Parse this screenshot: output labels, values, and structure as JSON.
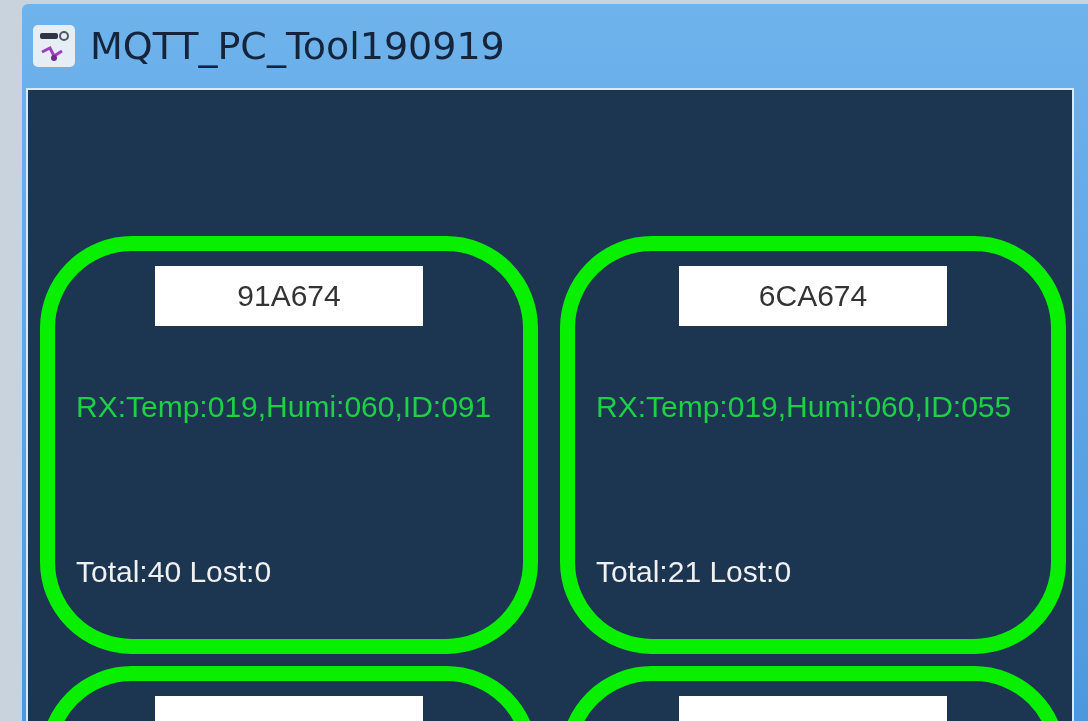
{
  "window": {
    "title": "MQTT_PC_Tool190919"
  },
  "cards": [
    {
      "kind": "full",
      "name": "91A674",
      "rx": "RX:Temp:019,Humi:060,ID:091",
      "stats": "Total:40 Lost:0"
    },
    {
      "kind": "full",
      "name": "6CA674",
      "rx": "RX:Temp:019,Humi:060,ID:055",
      "stats": "Total:21 Lost:0"
    },
    {
      "kind": "cut"
    },
    {
      "kind": "cut"
    }
  ]
}
